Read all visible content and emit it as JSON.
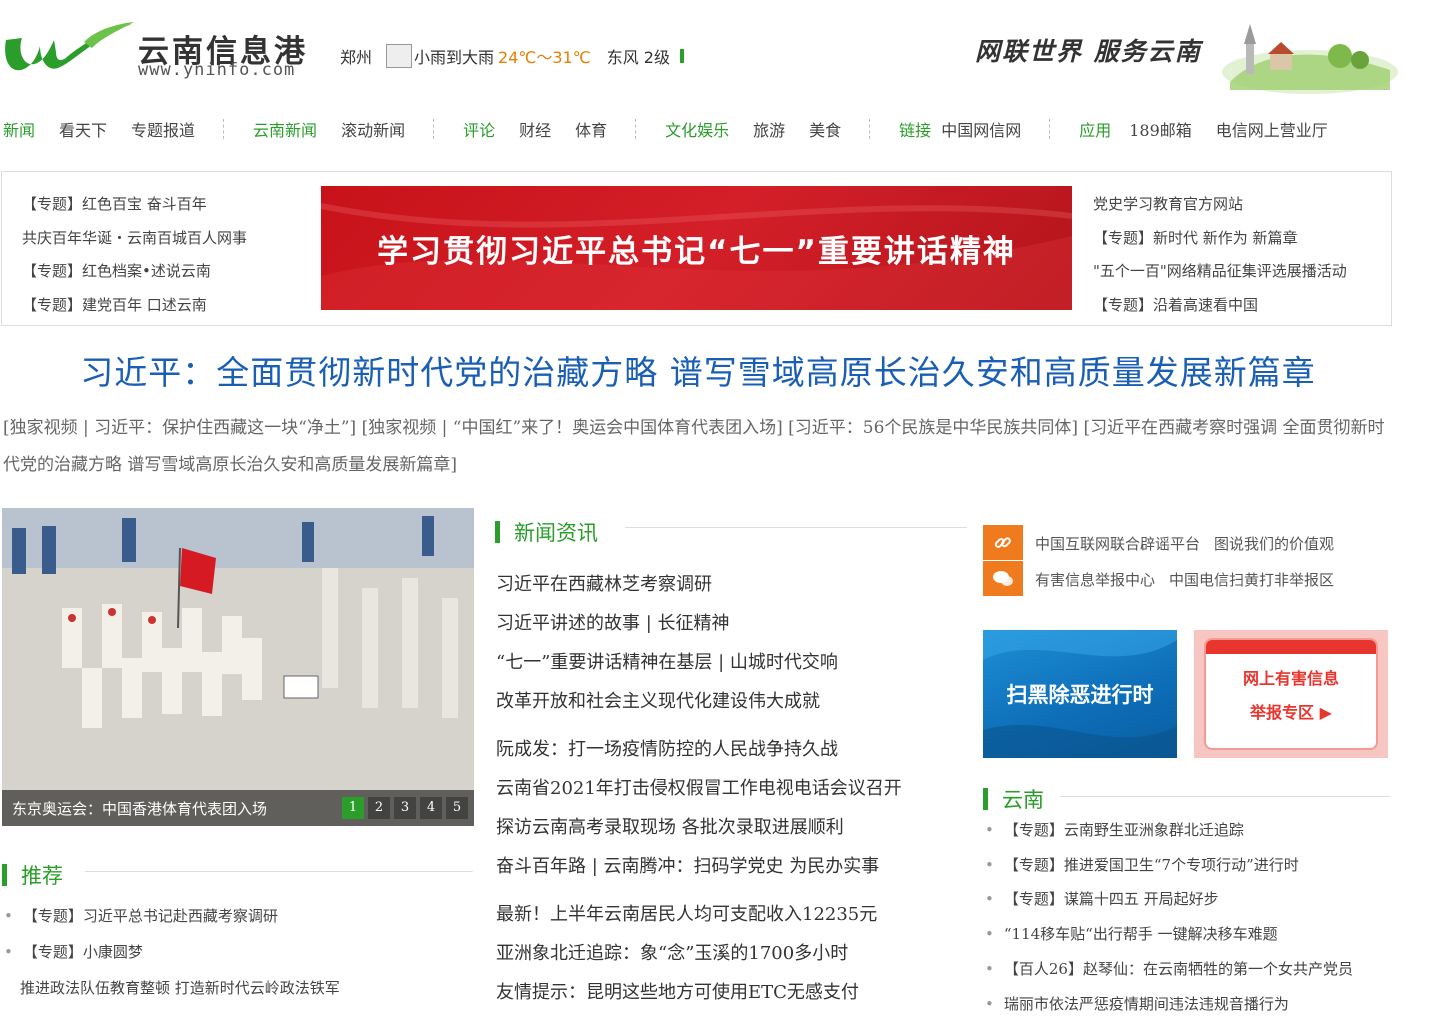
{
  "header": {
    "logo_title": "云南信息港",
    "logo_url": "www.yninfo.com",
    "weather_city": "郑州",
    "weather_desc": "小雨到大雨",
    "weather_temp": "24℃～31℃",
    "weather_wind": "东风 2级",
    "slogan": "网联世界  服务云南"
  },
  "nav": {
    "groups": [
      {
        "items": [
          "新闻",
          "看天下",
          "专题报道"
        ]
      },
      {
        "items": [
          "云南新闻",
          "滚动新闻"
        ]
      },
      {
        "items": [
          "评论",
          "财经",
          "体育"
        ]
      },
      {
        "items": [
          "文化娱乐",
          "旅游",
          "美食"
        ]
      },
      {
        "items": [
          "链接",
          "中国网信网"
        ]
      },
      {
        "items": [
          "应用",
          "189邮箱",
          "电信网上营业厅"
        ]
      }
    ]
  },
  "topbox": {
    "left_links": [
      "【专题】红色百宝 奋斗百年",
      "共庆百年华诞・云南百城百人网事",
      "【专题】红色档案•述说云南",
      "【专题】建党百年 口述云南"
    ],
    "banner_text": "学习贯彻习近平总书记“七一”重要讲话精神",
    "right_links": [
      "党史学习教育官方网站",
      "【专题】新时代 新作为 新篇章",
      "\"五个一百\"网络精品征集评选展播活动",
      "【专题】沿着高速看中国"
    ]
  },
  "headline": "习近平：全面贯彻新时代党的治藏方略  谱写雪域高原长治久安和高质量发展新篇章",
  "subline": "[独家视频 | 习近平：保护住西藏这一块“净土”] [独家视频 | “中国红”来了！奥运会中国体育代表团入场] [习近平：56个民族是中华民族共同体] [习近平在西藏考察时强调  全面贯彻新时代党的治藏方略  谱写雪域高原长治久安和高质量发展新篇章]",
  "photo": {
    "caption": "东京奥运会：中国香港体育代表团入场",
    "pages": [
      "1",
      "2",
      "3",
      "4",
      "5"
    ],
    "active_page": 1
  },
  "recommend": {
    "title": "推荐",
    "items": [
      "【专题】习近平总书记赴西藏考察调研",
      "【专题】小康圆梦",
      "推进政法队伍教育整顿  打造新时代云岭政法铁军"
    ]
  },
  "news": {
    "title": "新闻资讯",
    "groups": [
      [
        "习近平在西藏林芝考察调研",
        "习近平讲述的故事 | 长征精神",
        "“七一”重要讲话精神在基层 | 山城时代交响",
        "改革开放和社会主义现代化建设伟大成就"
      ],
      [
        "阮成发：打一场疫情防控的人民战争持久战",
        "云南省2021年打击侵权假冒工作电视电话会议召开",
        "探访云南高考录取现场  各批次录取进展顺利",
        "奋斗百年路  |  云南腾冲：扫码学党史  为民办实事"
      ],
      [
        "最新！上半年云南居民人均可支配收入12235元",
        "亚洲象北迁追踪：象“念”玉溪的1700多小时",
        "友情提示：昆明这些地方可使用ETC无感支付"
      ]
    ]
  },
  "quick": {
    "row1": [
      "中国互联网联合辟谣平台",
      "图说我们的价值观"
    ],
    "row2": [
      "有害信息举报中心",
      "中国电信扫黄打非举报区"
    ]
  },
  "ads": {
    "ad1": "扫黑除恶进行时",
    "ad2_line1": "网上有害信息",
    "ad2_line2": "举报专区 ▶"
  },
  "yunnan": {
    "title": "云南",
    "items": [
      "【专题】云南野生亚洲象群北迁追踪",
      "【专题】推进爱国卫生“7个专项行动”进行时",
      "【专题】谋篇十四五  开局起好步",
      "“114移车贴“出行帮手  一键解决移车难题",
      "【百人26】赵琴仙：在云南牺牲的第一个女共产党员",
      "瑞丽市依法严惩疫情期间违法违规音播行为"
    ]
  },
  "colors": {
    "brand_green": "#2a9d2a",
    "headline_blue": "#1a5fb4",
    "banner_red": "#c8121a",
    "accent_orange": "#f07a1e"
  }
}
